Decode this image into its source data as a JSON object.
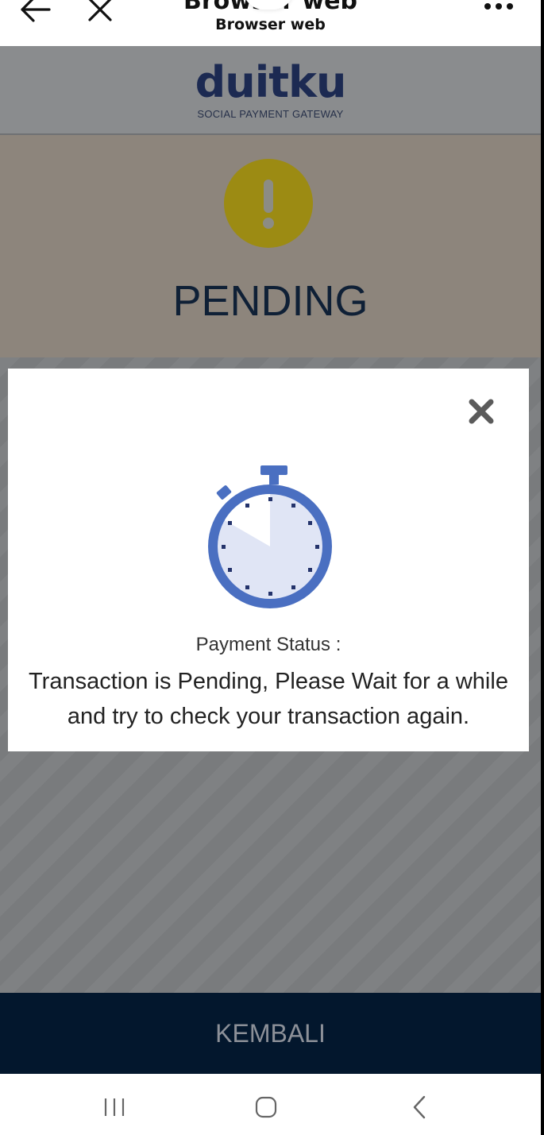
{
  "browser": {
    "title": "Browser web",
    "subtitle": "Browser web",
    "icons": {
      "back": "arrow-left-icon",
      "close": "close-icon",
      "more": "more-dots-icon"
    }
  },
  "header": {
    "logo_text": "duitku",
    "tagline": "SOCIAL PAYMENT GATEWAY"
  },
  "status": {
    "icon": "exclamation-icon",
    "label": "PENDING",
    "color": "#9c8b13"
  },
  "modal": {
    "close_icon": "close-x-icon",
    "icon": "stopwatch-icon",
    "status_label": "Payment Status :",
    "message": "Transaction is Pending, Please Wait for a while and try to check your transaction again."
  },
  "footer": {
    "button_label": "KEMBALI",
    "color": "#03172d"
  },
  "system_nav": {
    "icons": [
      "recents-icon",
      "home-icon",
      "back-chevron-icon"
    ]
  }
}
